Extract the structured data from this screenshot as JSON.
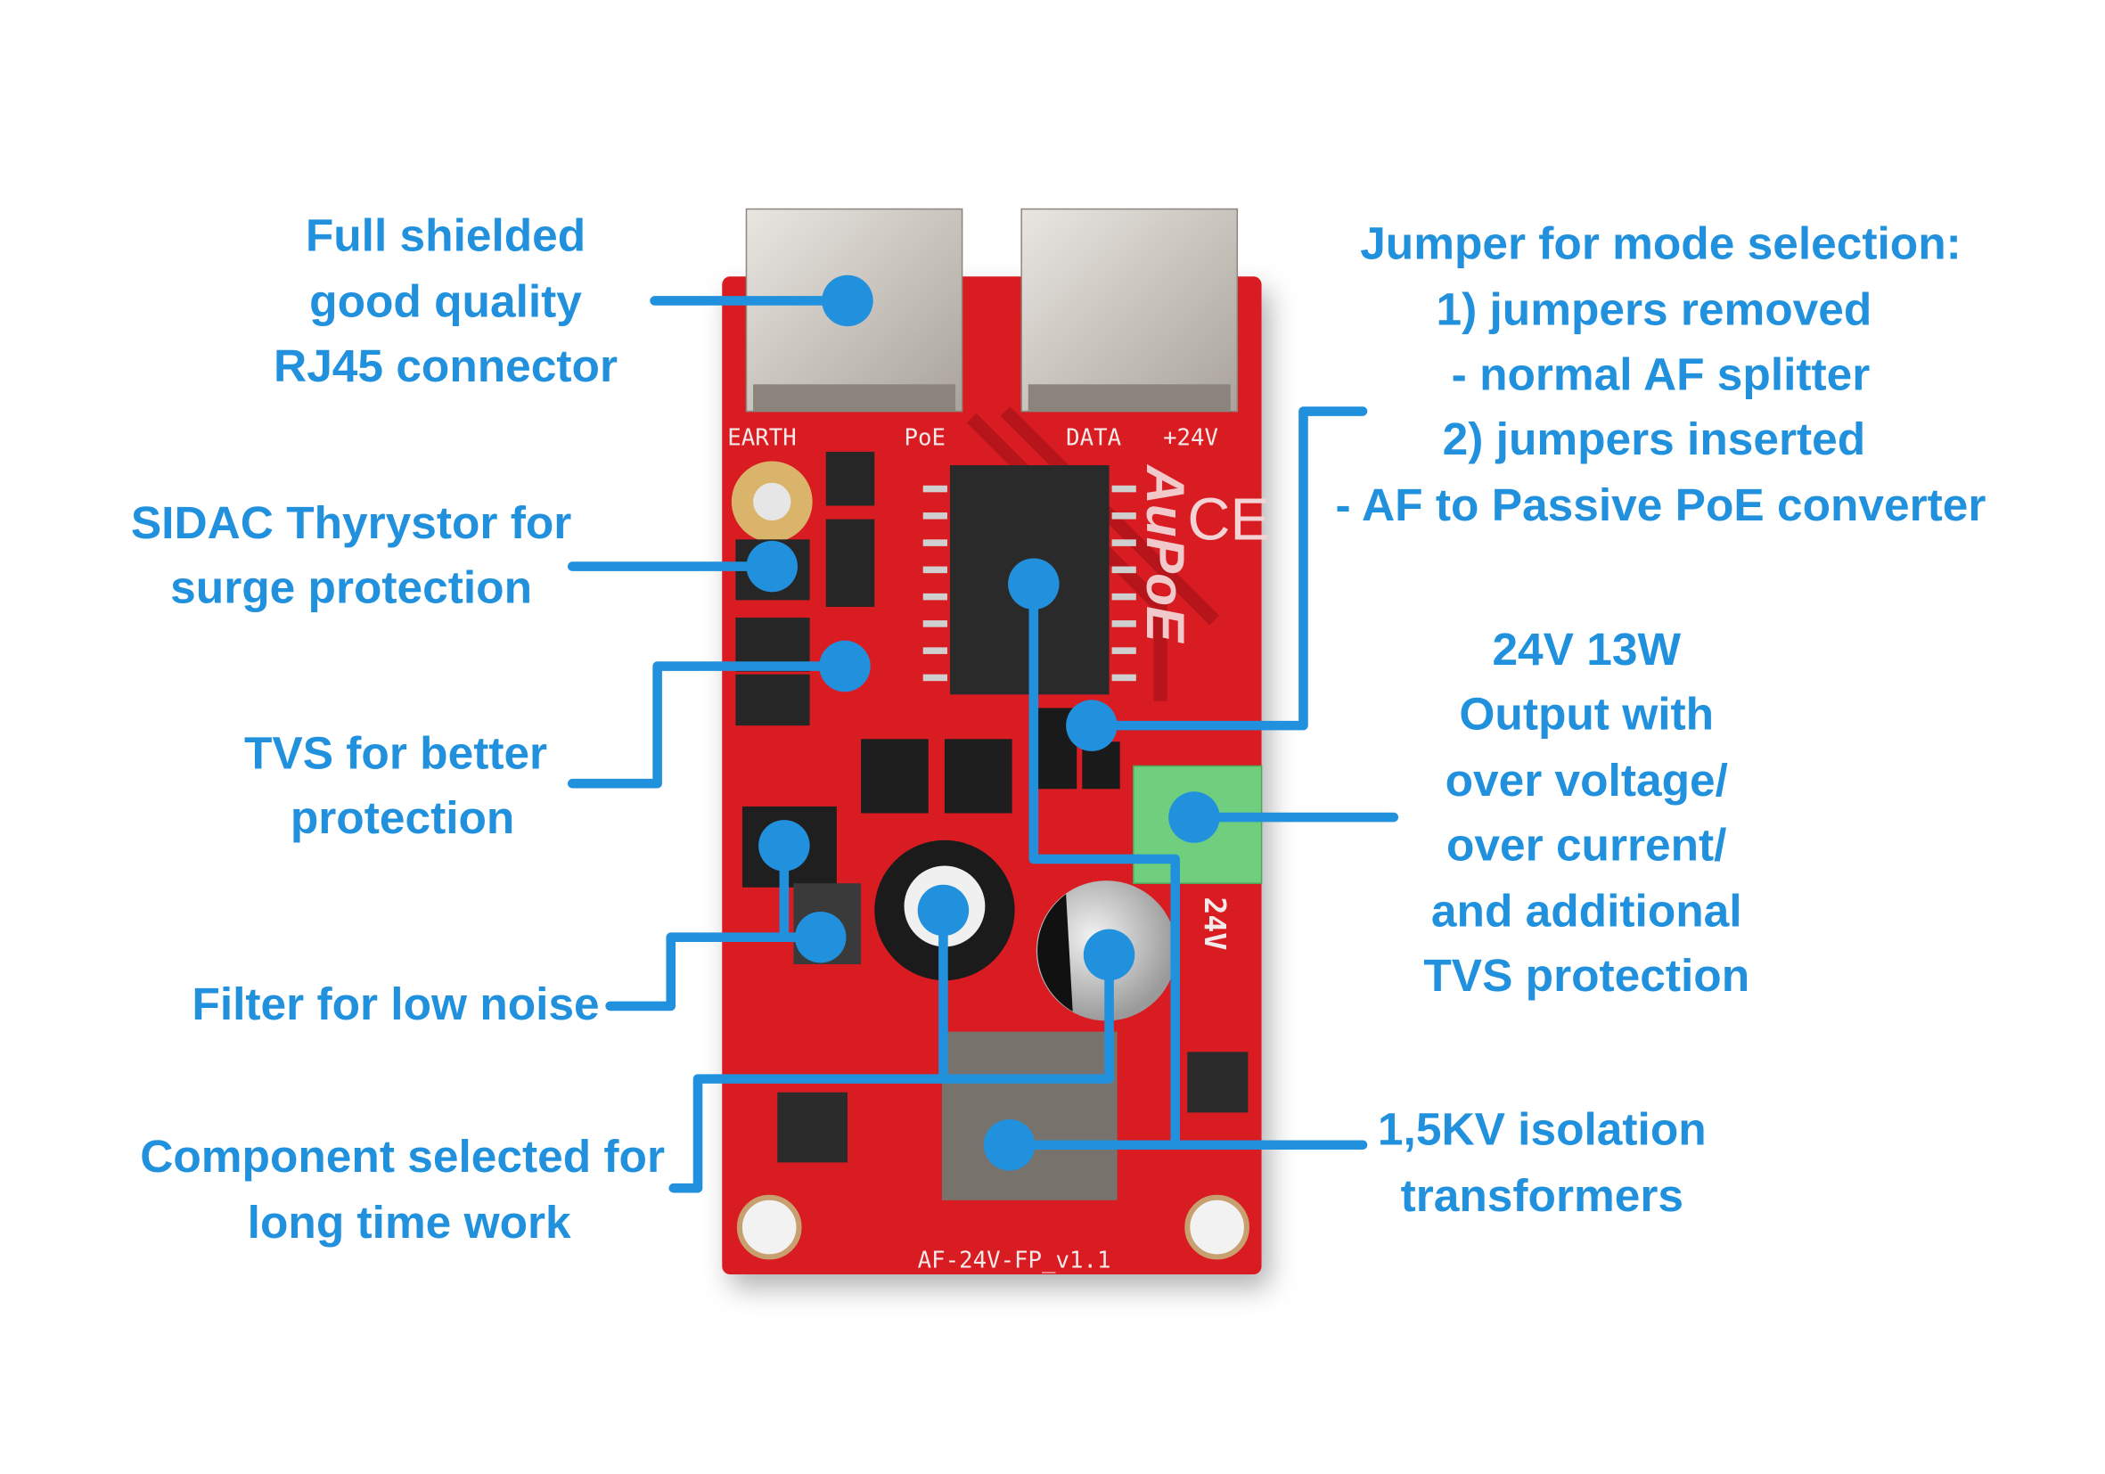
{
  "callouts": {
    "rj45": {
      "lines": [
        "Full shielded",
        "good quality",
        "RJ45 connector"
      ]
    },
    "sidac": {
      "lines": [
        "SIDAC Thyrystor for",
        "surge protection"
      ]
    },
    "tvs": {
      "lines": [
        "TVS for better",
        "protection"
      ]
    },
    "filter": {
      "lines": [
        "Filter for low noise"
      ]
    },
    "component": {
      "lines": [
        "Component selected for",
        "long time work"
      ]
    },
    "jumper": {
      "lines": [
        "Jumper for mode selection:",
        "1) jumpers removed",
        "- normal AF splitter",
        "2) jumpers inserted",
        "- AF to Passive PoE converter"
      ]
    },
    "output": {
      "lines": [
        "24V 13W",
        "Output with",
        "over voltage/",
        "over current/",
        "and additional",
        "TVS protection"
      ]
    },
    "isolation": {
      "lines": [
        "1,5KV isolation",
        "transformers"
      ]
    }
  },
  "board": {
    "silkscreen": {
      "earth": "EARTH",
      "poe": "PoE",
      "data": "DATA",
      "plus24v": "+24V",
      "v24": "24V",
      "model": "AF-24V-FP_v1.1",
      "brand": "AuPoE",
      "ce": "CE"
    }
  },
  "colors": {
    "accent": "#2191dd",
    "pcb": "#d81e24",
    "terminal": "#6fcf7f"
  }
}
